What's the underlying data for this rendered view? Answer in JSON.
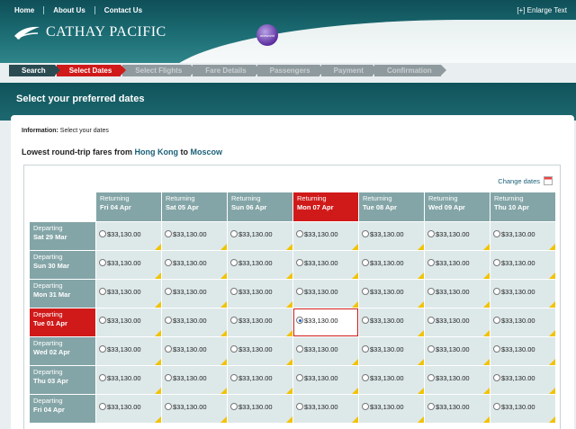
{
  "topnav": [
    "Home",
    "About Us",
    "Contact Us"
  ],
  "enlarge": "[+]  Enlarge Text",
  "brand": "CATHAY PACIFIC",
  "alliance": "oneworld",
  "steps": [
    {
      "label": "Search",
      "state": "done"
    },
    {
      "label": "Select Dates",
      "state": "active"
    },
    {
      "label": "Select Flights",
      "state": "todo"
    },
    {
      "label": "Fare Details",
      "state": "todo"
    },
    {
      "label": "Passengers",
      "state": "todo"
    },
    {
      "label": "Payment",
      "state": "todo"
    },
    {
      "label": "Confirmation",
      "state": "todo"
    }
  ],
  "page_title": "Select your preferred dates",
  "info_label": "Information:",
  "info_text": " Select your dates",
  "fares_prefix": "Lowest round-trip fares from ",
  "origin": "Hong Kong",
  "fares_mid": " to ",
  "destination": "Moscow",
  "change_dates": "Change dates",
  "returning_label": "Returning",
  "departing_label": "Departing",
  "returning": [
    "Fri 04 Apr",
    "Sat 05 Apr",
    "Sun 06 Apr",
    "Mon 07 Apr",
    "Tue 08 Apr",
    "Wed 09 Apr",
    "Thu 10 Apr"
  ],
  "departing": [
    "Sat 29 Mar",
    "Sun 30 Mar",
    "Mon 31 Mar",
    "Tue 01 Apr",
    "Wed 02 Apr",
    "Thu 03 Apr",
    "Fri 04 Apr"
  ],
  "selected_return_index": 3,
  "selected_depart_index": 3,
  "price": "$33,130.00",
  "colors": {
    "accent_red": "#d01a1a",
    "header_teal": "#1c6d74",
    "grid_cell": "#dde8e9",
    "grid_header": "#84a5a7",
    "flag_yellow": "#f2c200"
  }
}
